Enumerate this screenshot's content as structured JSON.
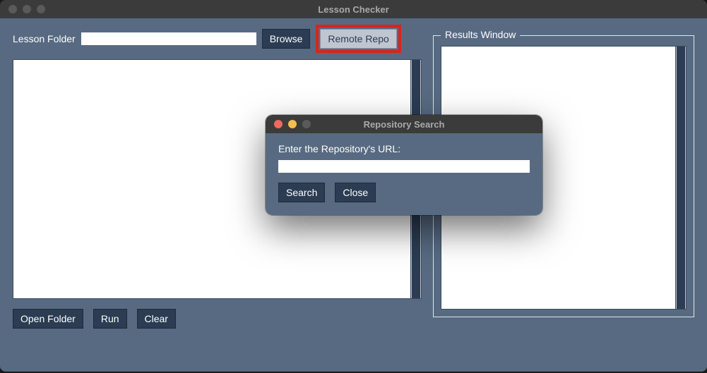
{
  "window": {
    "title": "Lesson Checker"
  },
  "left": {
    "folder_label": "Lesson Folder",
    "folder_value": "",
    "browse_label": "Browse",
    "remote_repo_label": "Remote Repo",
    "open_folder_label": "Open Folder",
    "run_label": "Run",
    "clear_label": "Clear"
  },
  "right": {
    "results_legend": "Results Window"
  },
  "dialog": {
    "title": "Repository Search",
    "prompt": "Enter the Repository's URL:",
    "url_value": "",
    "search_label": "Search",
    "close_label": "Close"
  },
  "colors": {
    "panel_bg": "#576a81",
    "button_bg": "#2b3c53",
    "highlight": "#d9241c"
  }
}
